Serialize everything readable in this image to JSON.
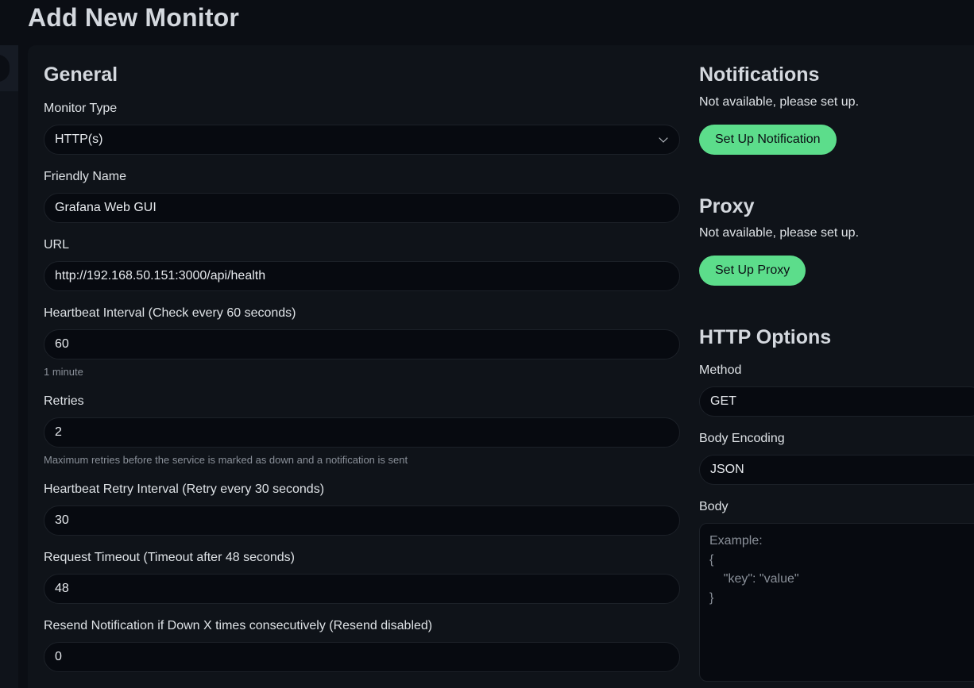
{
  "header": {
    "title": "Add New Monitor"
  },
  "general": {
    "title": "General",
    "monitor_type": {
      "label": "Monitor Type",
      "value": "HTTP(s)"
    },
    "friendly_name": {
      "label": "Friendly Name",
      "value": "Grafana Web GUI"
    },
    "url": {
      "label": "URL",
      "value": "http://192.168.50.151:3000/api/health"
    },
    "interval": {
      "label": "Heartbeat Interval (Check every 60 seconds)",
      "value": "60",
      "hint": "1 minute"
    },
    "retries": {
      "label": "Retries",
      "value": "2",
      "hint": "Maximum retries before the service is marked as down and a notification is sent"
    },
    "retry_interval": {
      "label": "Heartbeat Retry Interval (Retry every 30 seconds)",
      "value": "30"
    },
    "timeout": {
      "label": "Request Timeout (Timeout after 48 seconds)",
      "value": "48"
    },
    "resend": {
      "label": "Resend Notification if Down X times consecutively (Resend disabled)",
      "value": "0"
    }
  },
  "notifications": {
    "title": "Notifications",
    "note": "Not available, please set up.",
    "button": "Set Up Notification"
  },
  "proxy": {
    "title": "Proxy",
    "note": "Not available, please set up.",
    "button": "Set Up Proxy"
  },
  "http_options": {
    "title": "HTTP Options",
    "method": {
      "label": "Method",
      "value": "GET"
    },
    "body_encoding": {
      "label": "Body Encoding",
      "value": "JSON"
    },
    "body": {
      "label": "Body",
      "placeholder": "Example:\n{\n    \"key\": \"value\"\n}"
    }
  },
  "colors": {
    "accent": "#5cdd8b",
    "background": "#0b0e14",
    "panel": "#0f1319"
  }
}
